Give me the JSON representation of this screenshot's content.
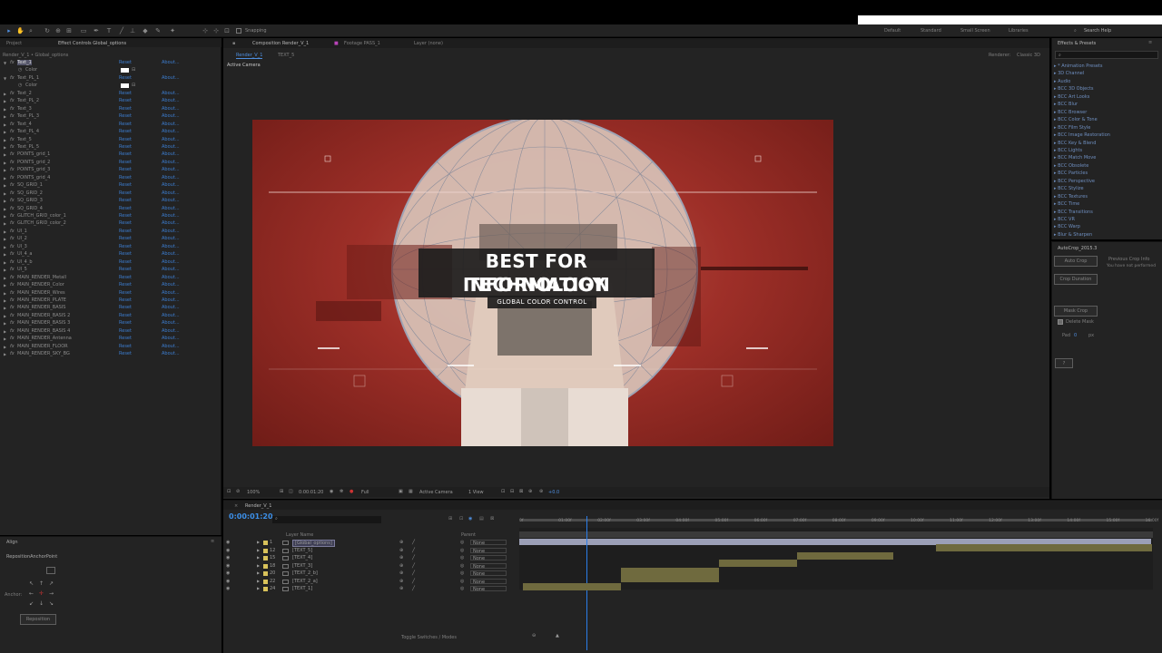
{
  "toolbar": {
    "snapping_label": "Snapping",
    "workspaces": [
      "Default",
      "Standard",
      "Small Screen",
      "Libraries"
    ],
    "search_help": "Search Help"
  },
  "project_panel": {
    "tab_project": "Project",
    "tab_effect_controls": "Effect Controls Global_options",
    "breadcrumb": "Render_V_1 • Global_options",
    "rows": [
      {
        "name": "Text_1",
        "reset": "Reset",
        "about": "About...",
        "expanded": true,
        "selected": true
      },
      {
        "name": "Color",
        "sub": true
      },
      {
        "name": "Text_PL_1",
        "reset": "Reset",
        "about": "About...",
        "expanded": true
      },
      {
        "name": "Color",
        "sub": true
      },
      {
        "name": "Text_2",
        "reset": "Reset",
        "about": "About..."
      },
      {
        "name": "Text_PL_2",
        "reset": "Reset",
        "about": "About..."
      },
      {
        "name": "Text_3",
        "reset": "Reset",
        "about": "About..."
      },
      {
        "name": "Text_PL_3",
        "reset": "Reset",
        "about": "About..."
      },
      {
        "name": "Text_4",
        "reset": "Reset",
        "about": "About..."
      },
      {
        "name": "Text_PL_4",
        "reset": "Reset",
        "about": "About..."
      },
      {
        "name": "Text_5",
        "reset": "Reset",
        "about": "About..."
      },
      {
        "name": "Text_PL_5",
        "reset": "Reset",
        "about": "About..."
      },
      {
        "name": "POINTS_grid_1",
        "reset": "Reset",
        "about": "About..."
      },
      {
        "name": "POINTS_grid_2",
        "reset": "Reset",
        "about": "About..."
      },
      {
        "name": "POINTS_grid_3",
        "reset": "Reset",
        "about": "About..."
      },
      {
        "name": "POINTS_grid_4",
        "reset": "Reset",
        "about": "About..."
      },
      {
        "name": "SQ_GRID_1",
        "reset": "Reset",
        "about": "About..."
      },
      {
        "name": "SQ_GRID_2",
        "reset": "Reset",
        "about": "About..."
      },
      {
        "name": "SQ_GRID_3",
        "reset": "Reset",
        "about": "About..."
      },
      {
        "name": "SQ_GRID_4",
        "reset": "Reset",
        "about": "About..."
      },
      {
        "name": "GLITCH_GRID_color_1",
        "reset": "Reset",
        "about": "About..."
      },
      {
        "name": "GLITCH_GRID_color_2",
        "reset": "Reset",
        "about": "About..."
      },
      {
        "name": "UI_1",
        "reset": "Reset",
        "about": "About..."
      },
      {
        "name": "UI_2",
        "reset": "Reset",
        "about": "About..."
      },
      {
        "name": "UI_3",
        "reset": "Reset",
        "about": "About..."
      },
      {
        "name": "UI_4_a",
        "reset": "Reset",
        "about": "About..."
      },
      {
        "name": "UI_4_b",
        "reset": "Reset",
        "about": "About..."
      },
      {
        "name": "UI_5",
        "reset": "Reset",
        "about": "About..."
      },
      {
        "name": "MAIN_RENDER_Metall",
        "reset": "Reset",
        "about": "About..."
      },
      {
        "name": "MAIN_RENDER_Color",
        "reset": "Reset",
        "about": "About..."
      },
      {
        "name": "MAIN_RENDER_Wires",
        "reset": "Reset",
        "about": "About..."
      },
      {
        "name": "MAIN_RENDER_PLATE",
        "reset": "Reset",
        "about": "About..."
      },
      {
        "name": "MAIN_RENDER_BASIS",
        "reset": "Reset",
        "about": "About..."
      },
      {
        "name": "MAIN_RENDER_BASIS 2",
        "reset": "Reset",
        "about": "About..."
      },
      {
        "name": "MAIN_RENDER_BASIS 3",
        "reset": "Reset",
        "about": "About..."
      },
      {
        "name": "MAIN_RENDER_BASIS 4",
        "reset": "Reset",
        "about": "About..."
      },
      {
        "name": "MAIN_RENDER_Antenna",
        "reset": "Reset",
        "about": "About..."
      },
      {
        "name": "MAIN_RENDER_FLOOR",
        "reset": "Reset",
        "about": "About..."
      },
      {
        "name": "MAIN_RENDER_SKY_BG",
        "reset": "Reset",
        "about": "About..."
      }
    ]
  },
  "align_panel": {
    "title": "Align",
    "script_name": "RepositionAnchorPoint",
    "anchor_label": "Anchor:",
    "reposition_button": "Reposition"
  },
  "composition": {
    "tab_composition": "Composition Render_V_1",
    "tab_footage": "Footage PASS_1",
    "tab_layer": "Layer (none)",
    "sub_tab_render": "Render_V_1",
    "sub_tab_text": "TEXT_5",
    "renderer": "Renderer:",
    "renderer_value": "Classic 3D",
    "active_camera": "Active Camera",
    "headline_1": "BEST FOR INFORMATION",
    "headline_2": "TECHNOLOGY",
    "subline": "GLOBAL COLOR CONTROL",
    "zoom": "100%",
    "timecode": "0:00:01:20",
    "resolution": "Full",
    "camera": "Active Camera",
    "view": "1 View",
    "exposure": "+0.0"
  },
  "effects_panel": {
    "title": "Effects & Presets",
    "items": [
      "* Animation Presets",
      "3D Channel",
      "Audio",
      "BCC 3D Objects",
      "BCC Art Looks",
      "BCC Blur",
      "BCC Browser",
      "BCC Color & Tone",
      "BCC Film Style",
      "BCC Image Restoration",
      "BCC Key & Blend",
      "BCC Lights",
      "BCC Match Move",
      "BCC Obsolete",
      "BCC Particles",
      "BCC Perspective",
      "BCC Stylize",
      "BCC Textures",
      "BCC Time",
      "BCC Transitions",
      "BCC VR",
      "BCC Warp",
      "Blur & Sharpen"
    ]
  },
  "autocrop_panel": {
    "title": "AutoCrop_2015.3",
    "auto_crop": "Auto Crop",
    "crop_duration": "Crop Duration",
    "previous_info": "Previous Crop Info",
    "not_performed": "You have not performed",
    "mask_crop": "Mask Crop",
    "delete_mask": "Delete Mask",
    "pad_label": "Pad",
    "pad_value": "0",
    "pad_unit": "px",
    "help": "?"
  },
  "timeline": {
    "tab": "Render_V_1",
    "timecode": "0:00:01:20",
    "col_layer": "Layer Name",
    "col_parent": "Parent",
    "toggle_label": "Toggle Switches / Modes",
    "ruler": [
      "0f",
      "01:00f",
      "02:00f",
      "03:00f",
      "04:00f",
      "05:00f",
      "06:00f",
      "07:00f",
      "08:00f",
      "09:00f",
      "10:00f",
      "11:00f",
      "12:00f",
      "13:00f",
      "14:00f",
      "15:00f",
      "16:00f"
    ],
    "layers": [
      {
        "num": "1",
        "name": "[Global_options]",
        "parent": "None"
      },
      {
        "num": "12",
        "name": "[TEXT_5]",
        "parent": "None"
      },
      {
        "num": "15",
        "name": "[TEXT_4]",
        "parent": "None"
      },
      {
        "num": "18",
        "name": "[TEXT_3]",
        "parent": "None"
      },
      {
        "num": "20",
        "name": "[TEXT_2_b]",
        "parent": "None"
      },
      {
        "num": "22",
        "name": "[TEXT_2_a]",
        "parent": "None"
      },
      {
        "num": "24",
        "name": "[TEXT_1]",
        "parent": "None"
      }
    ]
  },
  "colors": {
    "panel": "#232323",
    "accent_blue": "#3c7dd0",
    "clip": "#6f6a3e",
    "playhead": "#2b7de9"
  }
}
